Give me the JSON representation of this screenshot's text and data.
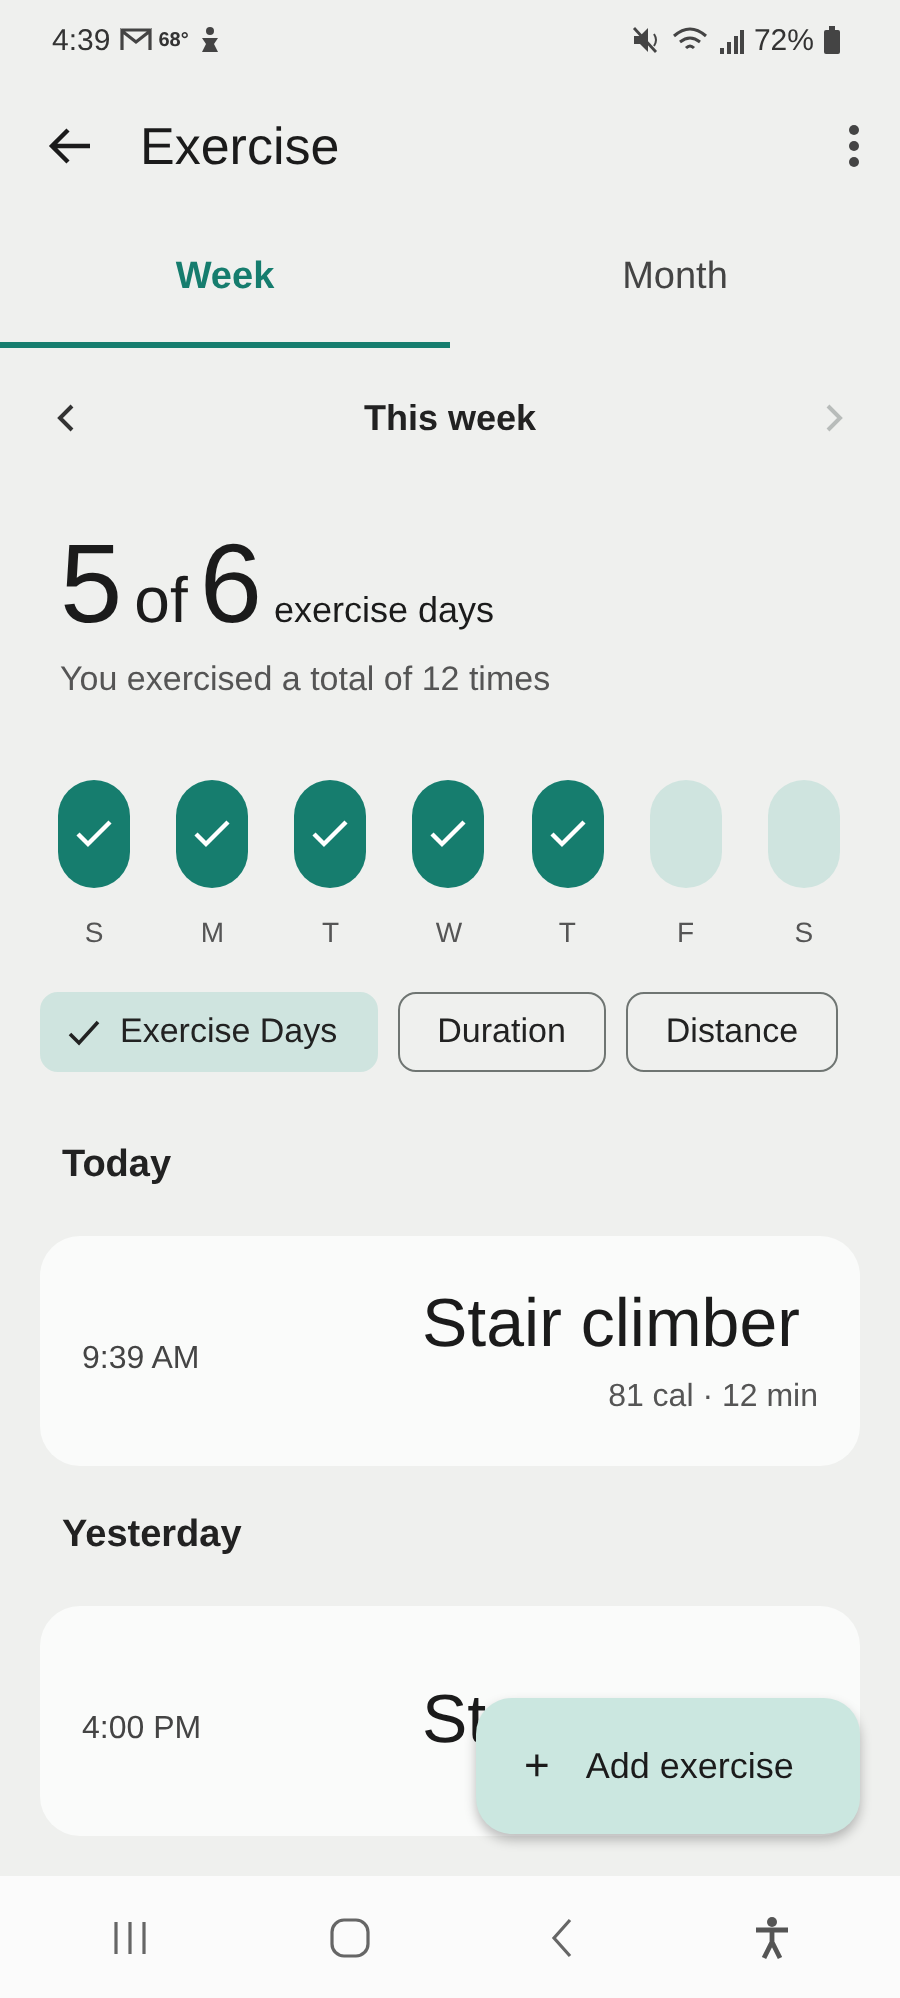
{
  "status_bar": {
    "time": "4:39",
    "temperature": "68°",
    "battery": "72%"
  },
  "app_bar": {
    "title": "Exercise"
  },
  "tabs": [
    {
      "label": "Week",
      "selected": true
    },
    {
      "label": "Month",
      "selected": false
    }
  ],
  "period": {
    "label": "This week",
    "next_disabled": true
  },
  "summary": {
    "count": "5",
    "of": "of",
    "goal": "6",
    "unit": "exercise days",
    "subtitle": "You exercised a total of 12 times"
  },
  "days": [
    {
      "letter": "S",
      "done": true
    },
    {
      "letter": "M",
      "done": true
    },
    {
      "letter": "T",
      "done": true
    },
    {
      "letter": "W",
      "done": true
    },
    {
      "letter": "T",
      "done": true
    },
    {
      "letter": "F",
      "done": false
    },
    {
      "letter": "S",
      "done": false
    }
  ],
  "chips": [
    {
      "label": "Exercise Days",
      "selected": true
    },
    {
      "label": "Duration",
      "selected": false
    },
    {
      "label": "Distance",
      "selected": false
    }
  ],
  "sections": [
    {
      "heading": "Today",
      "entries": [
        {
          "time": "9:39 AM",
          "name": "Stair climber",
          "details": "81 cal · 12 min"
        }
      ]
    },
    {
      "heading": "Yesterday",
      "entries": [
        {
          "time": "4:00 PM",
          "name": "St"
        }
      ]
    }
  ],
  "fab": {
    "label": "Add exercise",
    "icon": "+"
  }
}
